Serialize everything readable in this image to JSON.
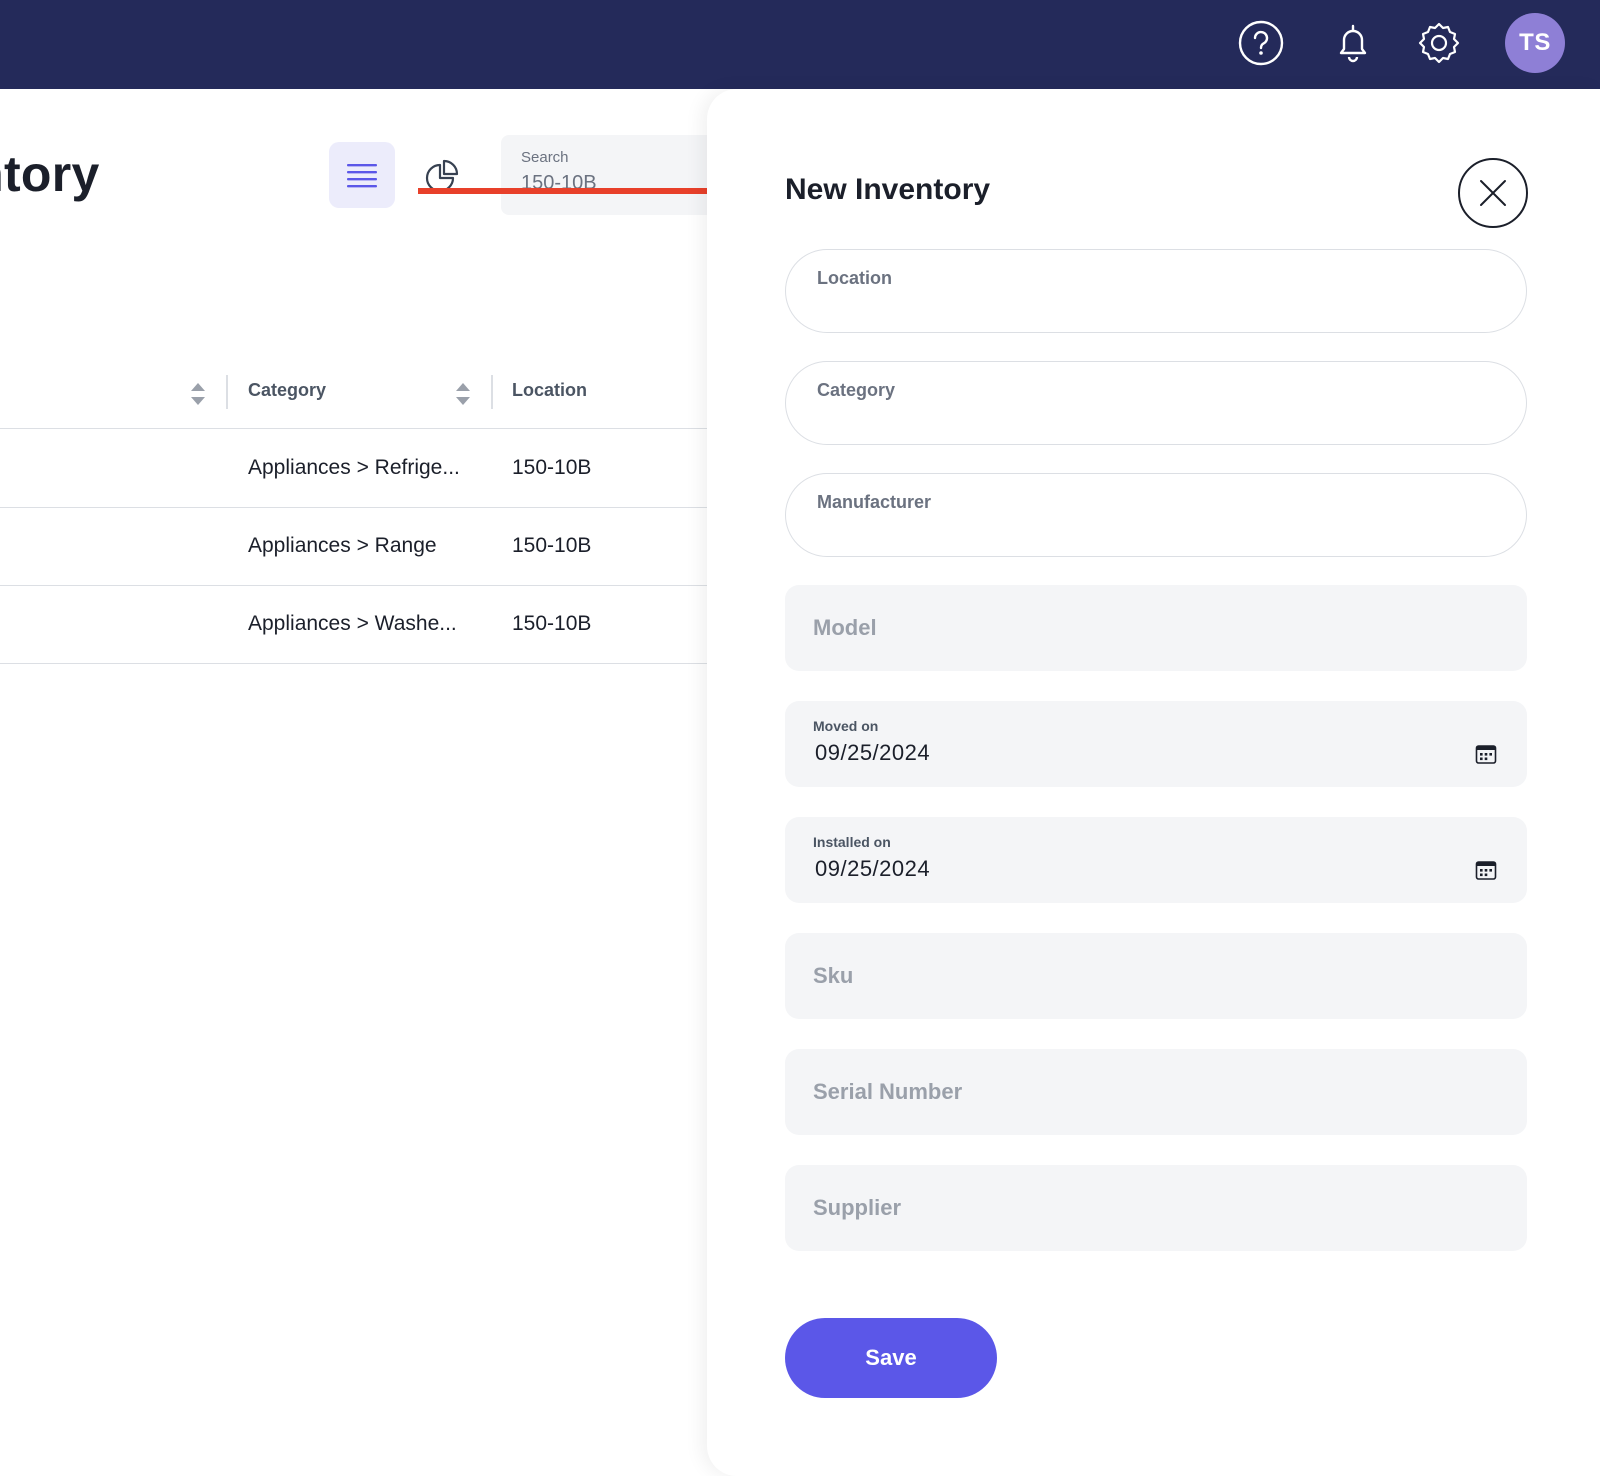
{
  "topbar": {
    "icons": [
      "help-icon",
      "bell-icon",
      "gear-icon"
    ],
    "avatar_initials": "TS",
    "background": "#242a5a",
    "avatar_color": "#8e7fd6"
  },
  "page": {
    "title": "entory",
    "search": {
      "label": "Search",
      "value": "150-10B"
    }
  },
  "table": {
    "headers": {
      "category": "Category",
      "location": "Location"
    },
    "rows": [
      {
        "category": "Appliances > Refrige...",
        "location": "150-10B"
      },
      {
        "category": "Appliances > Range",
        "location": "150-10B"
      },
      {
        "category": "Appliances > Washe...",
        "location": "150-10B"
      }
    ]
  },
  "drawer": {
    "title": "New Inventory",
    "fields": {
      "location": "Location",
      "category": "Category",
      "manufacturer": "Manufacturer",
      "model_placeholder": "Model",
      "moved_on": {
        "label": "Moved on",
        "value": "09/25/2024"
      },
      "installed_on": {
        "label": "Installed on",
        "value": "09/25/2024"
      },
      "sku_placeholder": "Sku",
      "serial_placeholder": "Serial Number",
      "supplier_placeholder": "Supplier"
    },
    "save_label": "Save",
    "accent": "#5b57e8"
  },
  "annotation": {
    "arrow_color": "#e8402a"
  }
}
